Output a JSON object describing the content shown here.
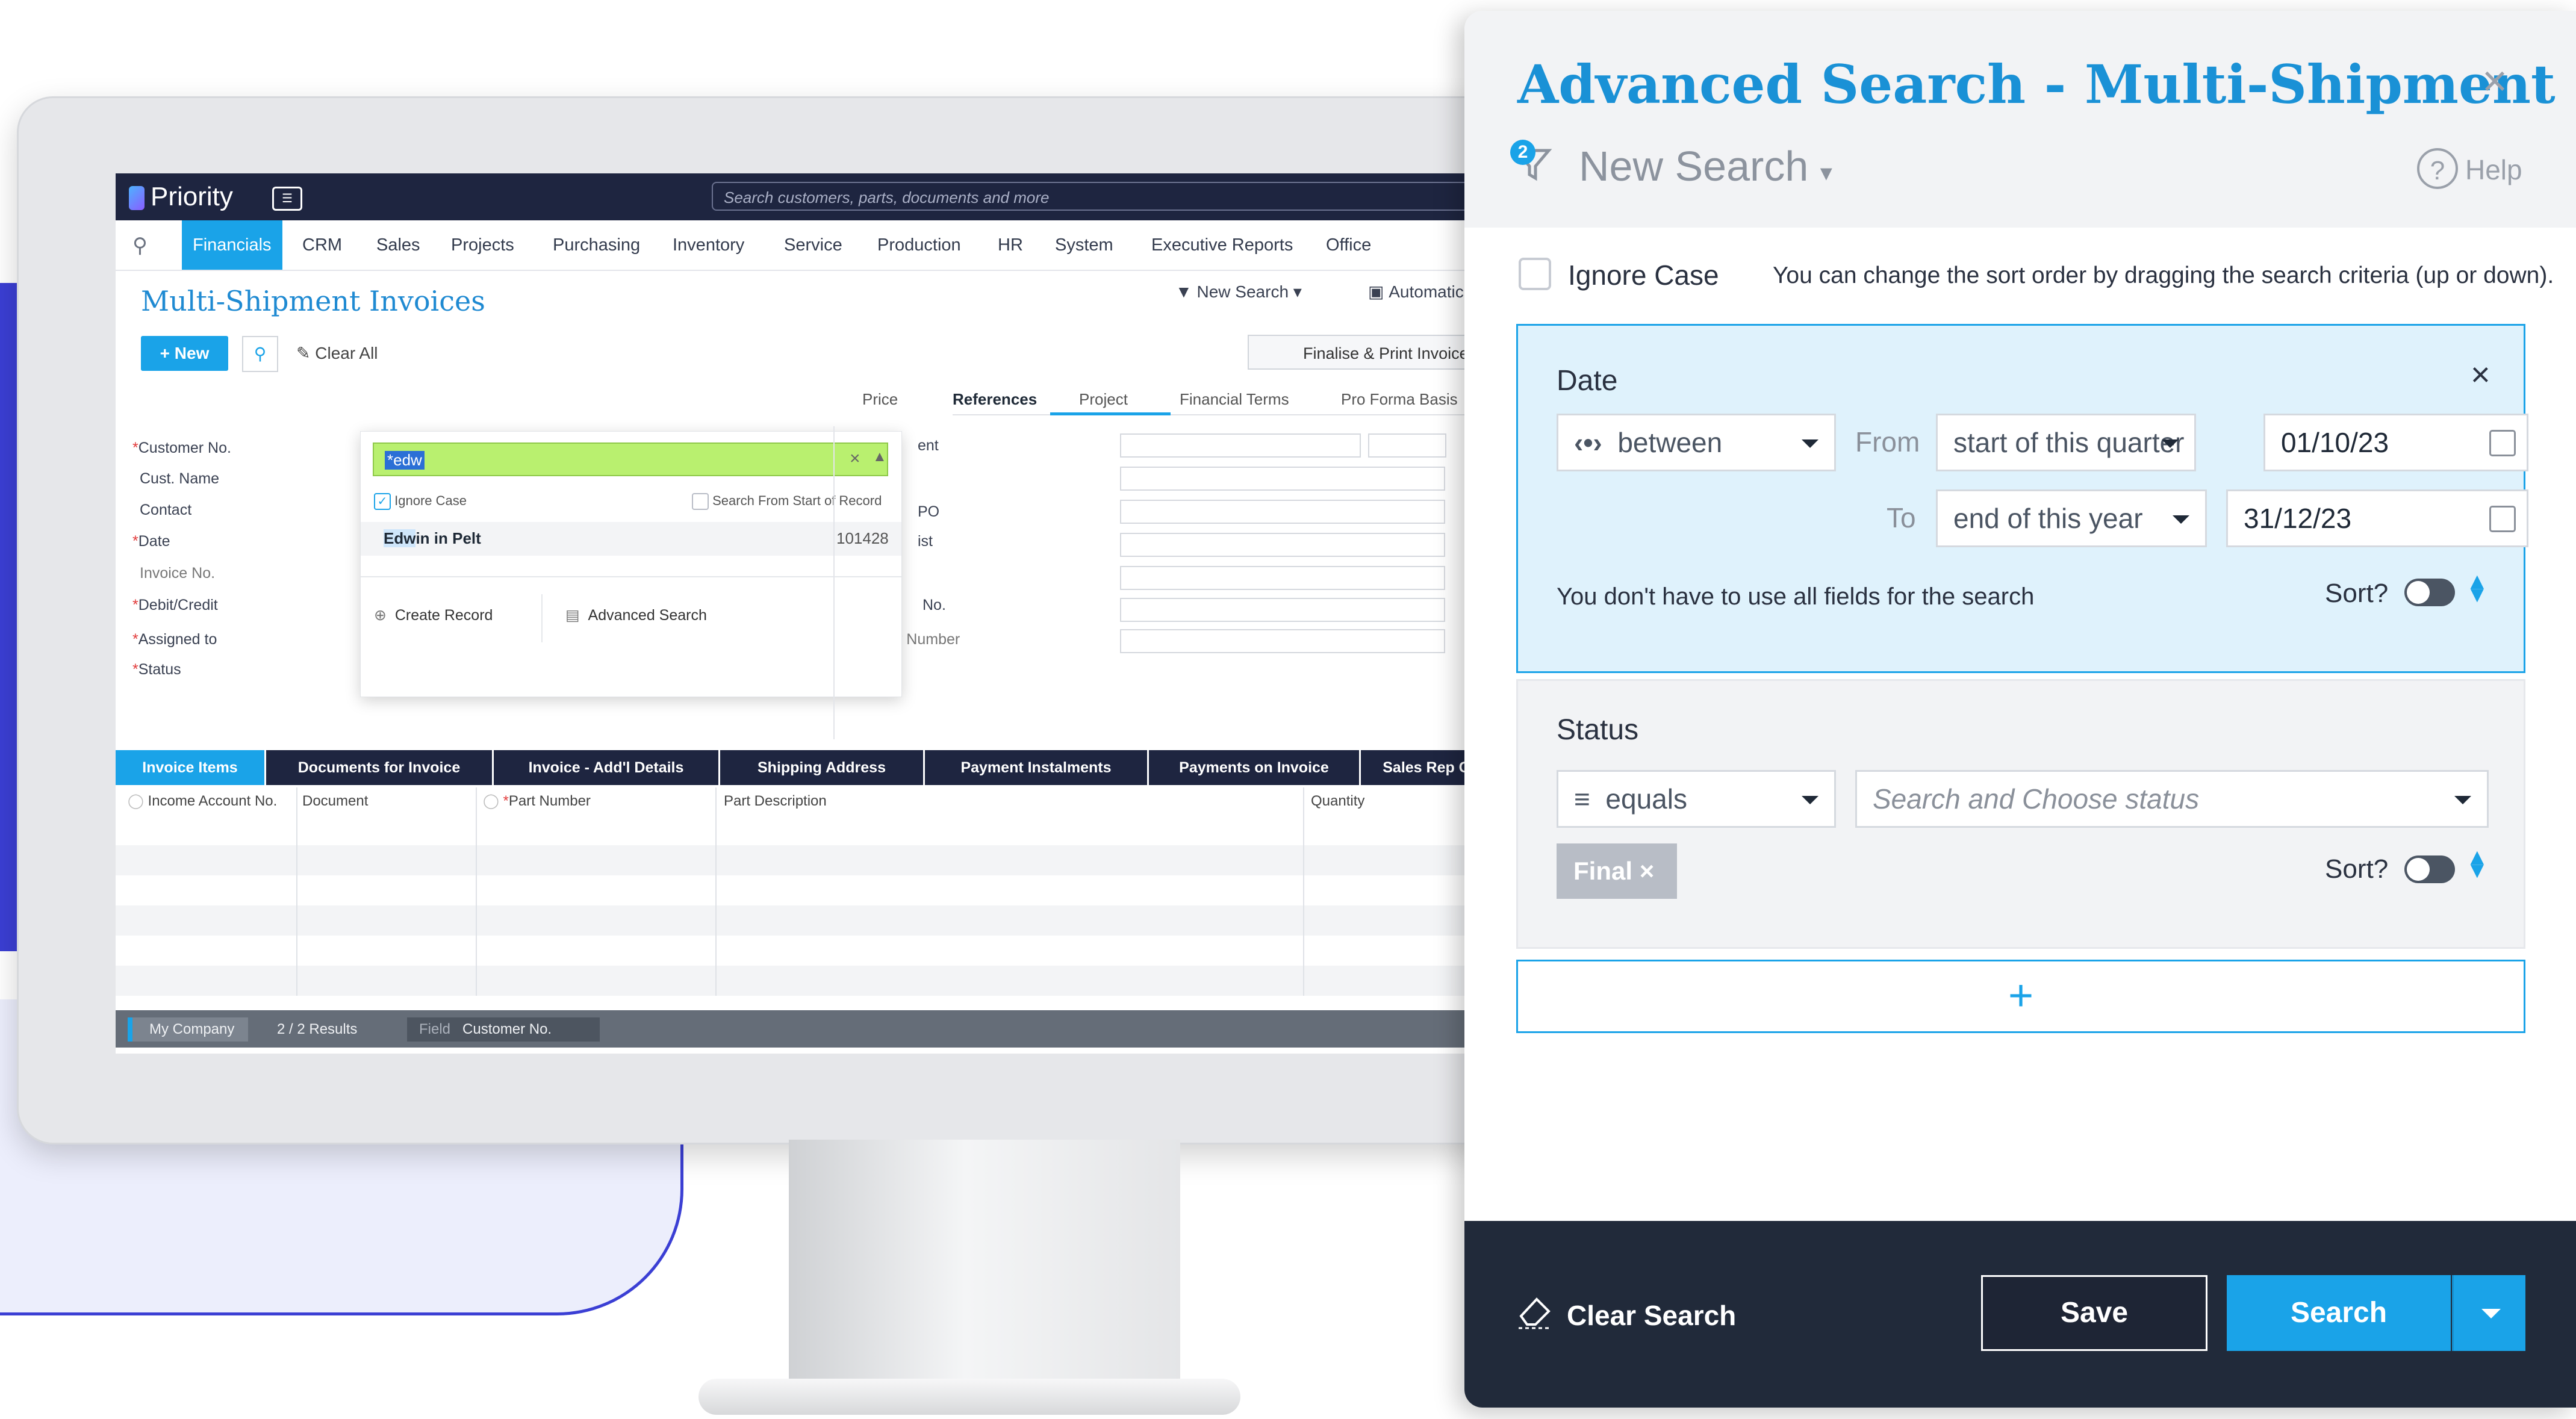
{
  "app": {
    "brand": "Priority",
    "global_search_placeholder": "Search customers, parts, documents and more",
    "menu": [
      "Financials",
      "CRM",
      "Sales",
      "Projects",
      "Purchasing",
      "Inventory",
      "Service",
      "Production",
      "HR",
      "System",
      "Executive Reports",
      "Office"
    ],
    "active_menu": "Financials"
  },
  "form": {
    "title": "Multi-Shipment Invoices",
    "new_label": "New",
    "clear_all_label": "Clear All",
    "new_search_label": "New Search",
    "automatic_label": "Automatic",
    "finalise_label": "Finalise & Print Invoice",
    "tabs": [
      "Price",
      "References",
      "Project",
      "Financial Terms",
      "Pro Forma Basis"
    ],
    "active_tab": "References",
    "fields": [
      "Customer No.",
      "Cust. Name",
      "Contact",
      "Date",
      "Invoice No.",
      "Debit/Credit",
      "Assigned to",
      "Status"
    ],
    "right_fragments": [
      "ent",
      "PO",
      "ist",
      "No.",
      "Entry Number"
    ]
  },
  "dropdown": {
    "input_value": "*edw",
    "ignore_case_label": "Ignore Case",
    "search_from_start_label": "Search From Start of Record",
    "result_highlight": "Edw",
    "result_rest": "in in Pelt",
    "result_number": "101428",
    "create_record_label": "Create Record",
    "advanced_search_label": "Advanced Search"
  },
  "subforms": {
    "tabs": [
      "Invoice Items",
      "Documents for Invoice",
      "Invoice - Add'l Details",
      "Shipping Address",
      "Payment Instalments",
      "Payments on Invoice",
      "Sales Rep C"
    ],
    "active_tab": "Invoice Items",
    "columns": [
      "Income Account No.",
      "Document",
      "Part Number",
      "Part Description",
      "Quantity"
    ]
  },
  "statusbar": {
    "company": "My Company",
    "results": "2 / 2 Results",
    "field_label": "Field",
    "field_value": "Customer No."
  },
  "advanced_search": {
    "title": "Advanced Search - Multi-Shipment I...",
    "badge_count": "2",
    "new_search_label": "New Search",
    "help_label": "Help",
    "ignore_case_label": "Ignore Case",
    "sort_hint": "You can change the sort order by dragging the search criteria (up or down).",
    "date": {
      "title": "Date",
      "operator": "between",
      "from_label": "From",
      "from_relative": "start of this quarter",
      "from_date": "01/10/23",
      "to_label": "To",
      "to_relative": "end of this year",
      "to_date": "31/12/23",
      "note": "You don't have to use all fields for the search",
      "sort_label": "Sort?"
    },
    "status": {
      "title": "Status",
      "operator": "equals",
      "placeholder": "Search and Choose status",
      "chip": "Final",
      "sort_label": "Sort?"
    },
    "add_label": "+",
    "clear_search_label": "Clear Search",
    "save_label": "Save",
    "search_label": "Search"
  },
  "colors": {
    "accent": "#1aa3e8",
    "title_blue": "#1a91d6",
    "dark_navy": "#1e2540",
    "deco_purple": "#3b3fd4",
    "green_input": "#b9f06f"
  }
}
